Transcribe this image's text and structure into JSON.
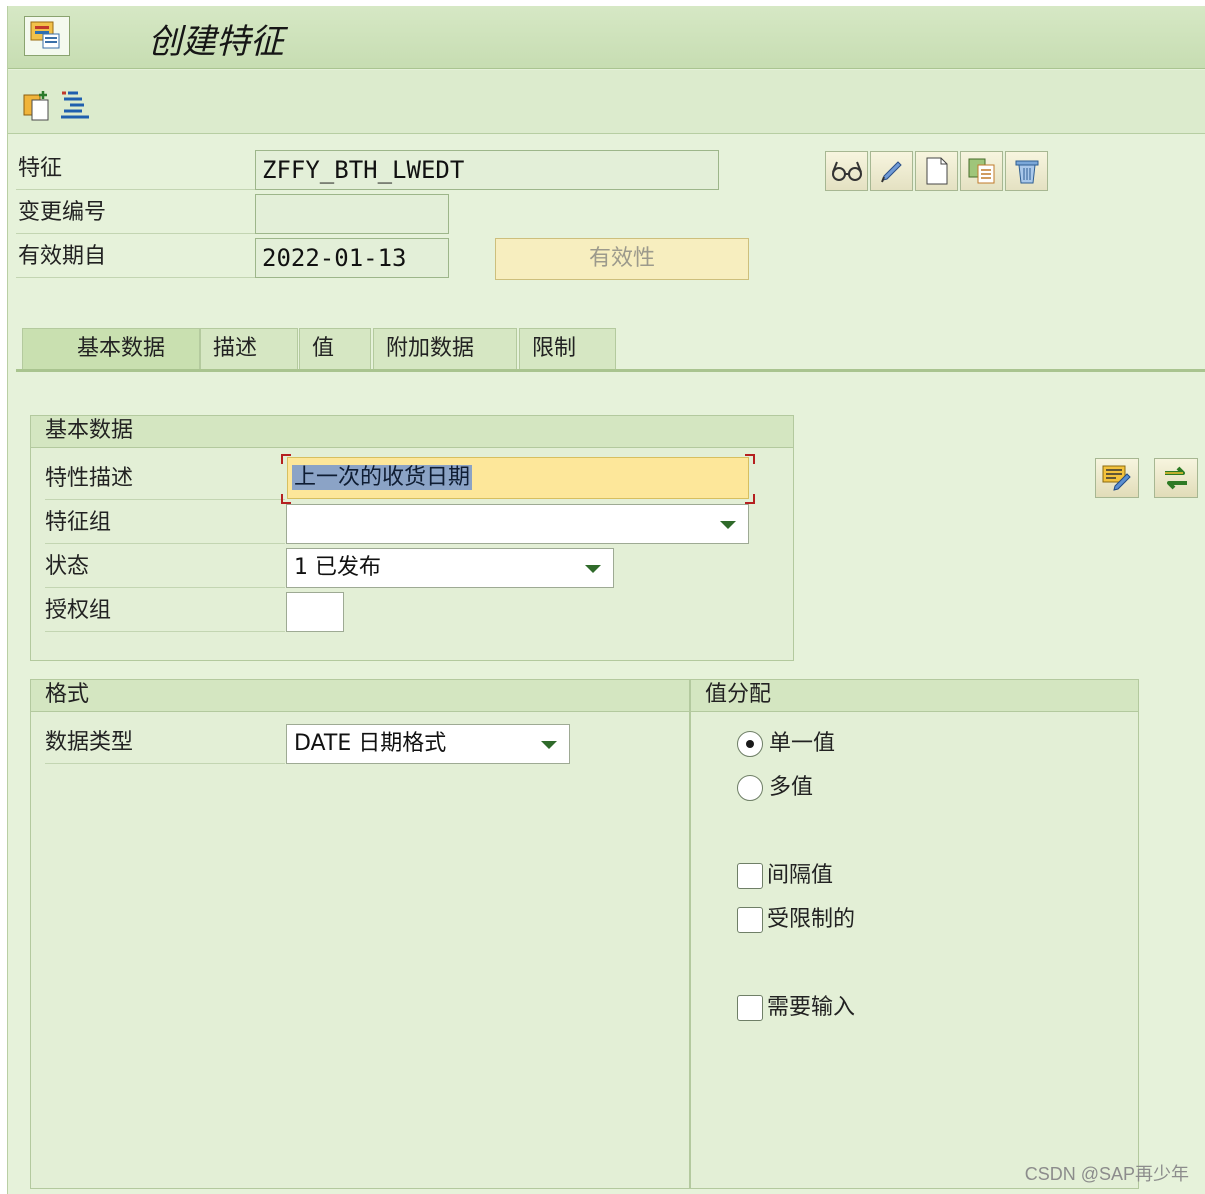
{
  "window": {
    "title": "创建特征"
  },
  "header_fields": {
    "characteristic_label": "特征",
    "characteristic_value": "ZFFY_BTH_LWEDT",
    "change_number_label": "变更编号",
    "change_number_value": "",
    "valid_from_label": "有效期自",
    "valid_from_value": "2022-01-13",
    "validity_button": "有效性"
  },
  "tabs": [
    {
      "label": "基本数据",
      "active": true
    },
    {
      "label": "描述"
    },
    {
      "label": "值"
    },
    {
      "label": "附加数据"
    },
    {
      "label": "限制"
    }
  ],
  "basic_data": {
    "title": "基本数据",
    "desc_label": "特性描述",
    "desc_value": "上一次的收货日期",
    "group_label": "特征组",
    "group_value": "",
    "status_label": "状态",
    "status_value": "1 已发布",
    "auth_label": "授权组",
    "auth_value": ""
  },
  "format": {
    "title": "格式",
    "datatype_label": "数据类型",
    "datatype_value": "DATE 日期格式"
  },
  "value_assignment": {
    "title": "值分配",
    "single": "单一值",
    "multiple": "多值",
    "selected": "single",
    "interval": "间隔值",
    "restricted": "受限制的",
    "required": "需要输入"
  },
  "watermark": "CSDN @SAP再少年",
  "colors": {
    "background": "#e6f2da",
    "header": "#c7ddb2",
    "focus_field": "#fde79a",
    "selection": "#8ba3c6"
  }
}
